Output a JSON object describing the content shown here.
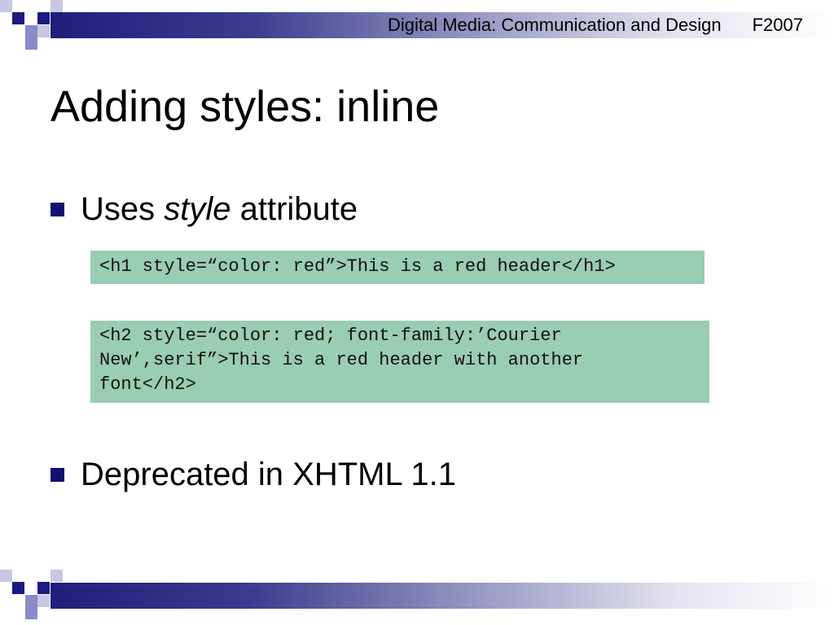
{
  "header": {
    "course": "Digital Media: Communication and Design",
    "term": "F2007"
  },
  "slide": {
    "title": "Adding styles: inline",
    "bullets": [
      {
        "pre": "Uses ",
        "em": "style",
        "post": " attribute"
      },
      {
        "text": "Deprecated in XHTML 1.1"
      }
    ],
    "code_blocks": [
      "<h1 style=“color: red”>This is a red header</h1>",
      "<h2 style=“color: red; font-family:’Courier\nNew’,serif”>This is a red header with another\nfont</h2>"
    ]
  },
  "colors": {
    "bar_dark": "#1f1f7a",
    "bullet": "#101070",
    "code_bg": "#99cdb4",
    "motif_dark": "#1a1a80",
    "motif_light": "#c8c8e4"
  }
}
